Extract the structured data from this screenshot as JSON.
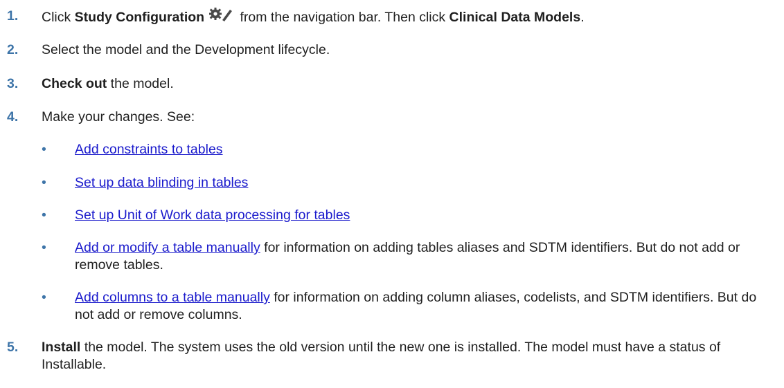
{
  "steps": [
    {
      "number": "1.",
      "parts": {
        "a": "Click ",
        "b": "Study Configuration",
        "c": " from the navigation bar. Then click ",
        "d": "Clinical Data Models",
        "e": "."
      },
      "icon": "study-configuration-gear-icon"
    },
    {
      "number": "2.",
      "text": "Select the model and the Development lifecycle."
    },
    {
      "number": "3.",
      "bold": "Check out",
      "text": " the model."
    },
    {
      "number": "4.",
      "text": "Make your changes. See:",
      "bullets": [
        {
          "bullet": "•",
          "link": "Add constraints to tables",
          "text": ""
        },
        {
          "bullet": "•",
          "link": "Set up data blinding in tables",
          "text": ""
        },
        {
          "bullet": "•",
          "link": "Set up Unit of Work data processing for tables",
          "text": ""
        },
        {
          "bullet": "•",
          "link": "Add or modify a table manually",
          "text": " for information on adding tables aliases and SDTM identifiers. But do not add or remove tables."
        },
        {
          "bullet": "•",
          "link": "Add columns to a table manually",
          "text": " for information on adding column aliases, codelists, and SDTM identifiers. But do not add or remove columns."
        }
      ]
    },
    {
      "number": "5.",
      "bold": "Install",
      "text": " the model. The system uses the old version until the new one is installed. The model must have a status of Installable."
    }
  ],
  "colors": {
    "step_number": "#3d74a8",
    "link": "#1a1acc",
    "text": "#1f1f1f"
  }
}
